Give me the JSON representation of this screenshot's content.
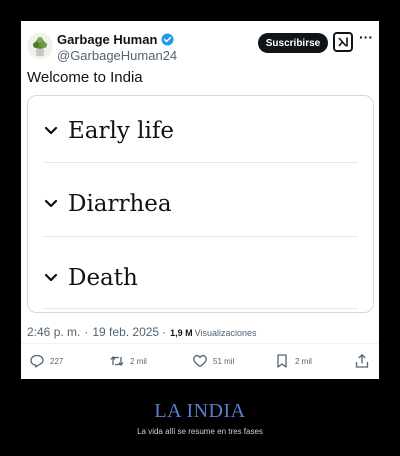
{
  "tweet": {
    "display_name": "Garbage Human",
    "handle": "@GarbageHuman24",
    "subscribe_label": "Suscribirse",
    "more_label": "···",
    "text": "Welcome to India",
    "verified_color": "#1d9bf0",
    "card": {
      "items": [
        {
          "label": "Early life"
        },
        {
          "label": "Diarrhea"
        },
        {
          "label": "Death"
        }
      ]
    },
    "meta": {
      "time": "2:46 p. m.",
      "separator": "·",
      "date": "19 feb. 2025",
      "views_count": "1,9 M",
      "views_label": "Visualizaciones"
    },
    "actions": {
      "replies": "227",
      "reposts": "2 mil",
      "likes": "51 mil",
      "bookmarks": "2 mil"
    },
    "icons": [
      "avatar-plant",
      "verified-badge-icon",
      "grok-icon",
      "more-icon",
      "reply-icon",
      "repost-icon",
      "like-icon",
      "bookmark-icon",
      "share-icon",
      "chevron-down-icon"
    ]
  },
  "caption": {
    "title": "LA INDIA",
    "subtitle": "La vida allí se resume en tres fases",
    "title_color": "#5b7fd1"
  }
}
